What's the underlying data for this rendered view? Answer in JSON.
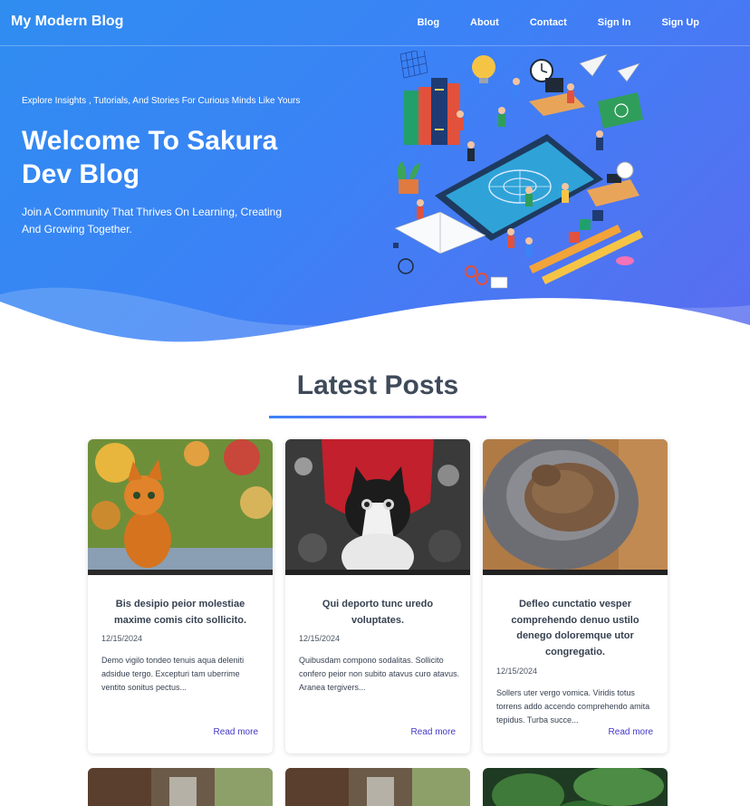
{
  "nav": {
    "brand": "My Modern Blog",
    "links": [
      "Blog",
      "About",
      "Contact",
      "Sign In",
      "Sign Up"
    ]
  },
  "hero": {
    "tagline": "Explore Insights , Tutorials, And Stories For Curious Minds Like Yours",
    "title": "Welcome To Sakura Dev Blog",
    "subtitle": "Join A Community That Thrives On Learning, Creating And Growing Together."
  },
  "latest": {
    "heading": "Latest Posts",
    "read_more": "Read more",
    "posts": [
      {
        "title": "Bis desipio peior molestiae maxime comis cito sollicito.",
        "date": "12/15/2024",
        "excerpt": "Demo vigilo tondeo tenuis aqua deleniti adsidue tergo. Excepturi tam uberrime ventito sonitus pectus...",
        "image": "painted-orange-kitten"
      },
      {
        "title": "Qui deporto tunc uredo voluptates.",
        "date": "12/15/2024",
        "excerpt": "Quibusdam compono sodalitas. Sollicito confero peior non subito atavus curo atavus. Aranea tergivers...",
        "image": "black-white-kitten-red-hat"
      },
      {
        "title": "Defleo cunctatio vesper comprehendo denuo ustilo denego doloremque utor congregatio.",
        "date": "12/15/2024",
        "excerpt": "Sollers uter vergo vomica. Viridis totus torrens addo accendo comprehendo amita tepidus. Turba succe...",
        "image": "cat-sleeping-in-bed"
      }
    ]
  },
  "colors": {
    "hero_start": "#2f8df0",
    "hero_end": "#5b6cf0",
    "heading": "#3f4a5a",
    "link": "#4338ca"
  }
}
